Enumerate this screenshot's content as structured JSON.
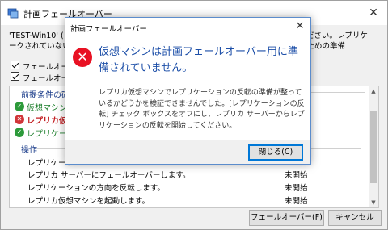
{
  "window": {
    "title": "計画フェールオーバー",
    "app_icon": "failover-app-icon",
    "close_glyph": "✕"
  },
  "background": {
    "message_left_lines": [
      "'TEST-Win10' (",
      "ークされていない"
    ],
    "message_right_lines": [
      "してください。レプリケ",
      "動するための準備"
    ],
    "checkboxes": [
      {
        "label": "フェールオー",
        "checked": true
      },
      {
        "label": "フェールオー",
        "checked": true
      }
    ],
    "prereq_header": "前提条件の確",
    "prereqs": [
      {
        "label": "仮想マシン",
        "status": "ok"
      },
      {
        "label": "レプリカ仮",
        "status": "error"
      },
      {
        "label": "レプリケーシ",
        "status": "ok"
      }
    ],
    "operations_header": "操作",
    "operations": [
      {
        "name": "レプリケート",
        "status": ""
      },
      {
        "name": "レプリカ サーバーにフェールオーバーします。",
        "status": "未開始"
      },
      {
        "name": "レプリケーションの方向を反転します。",
        "status": "未開始"
      },
      {
        "name": "レプリカ仮想マシンを起動します。",
        "status": "未開始"
      }
    ],
    "failover_button": "フェールオーバー(F)",
    "cancel_button": "キャンセル"
  },
  "dialog": {
    "title": "計画フェールオーバー",
    "close_glyph": "✕",
    "icon": "error-icon",
    "heading": "仮想マシンは計画フェールオーバー用に準備されていません。",
    "body": "レプリカ仮想マシンでレプリケーションの反転の準備が整っているかどうかを検証できませんでした。[レプリケーションの反転] チェック ボックスをオフにし、レプリカ サーバーからレプリケーションの反転を開始してください。",
    "ok_button": "閉じる(C)"
  },
  "colors": {
    "heading_blue": "#1d4fa8",
    "error_red": "#e81123",
    "ok_green": "#2c9a3a",
    "accent": "#0078d7"
  }
}
